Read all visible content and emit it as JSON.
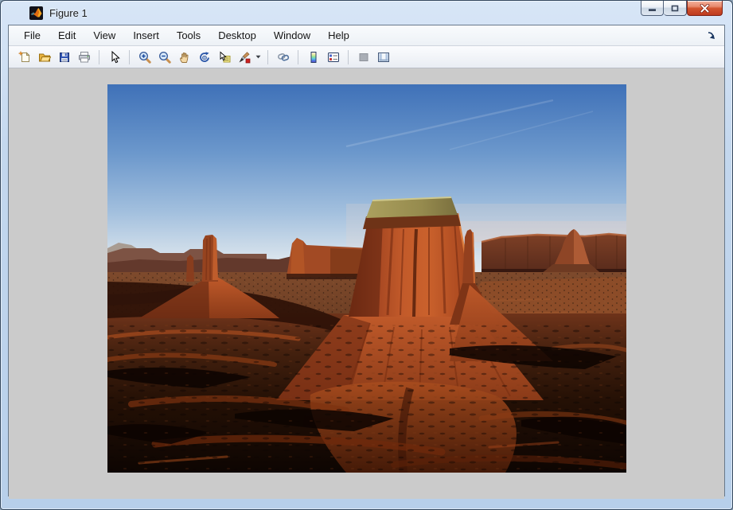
{
  "window": {
    "title": "Figure 1",
    "app_icon": "matlab-logo-icon",
    "controls": [
      {
        "name": "minimize-button",
        "glyph": "minimize"
      },
      {
        "name": "restore-button",
        "glyph": "restore"
      },
      {
        "name": "close-button",
        "glyph": "close"
      }
    ]
  },
  "menu_bar": {
    "items": [
      "File",
      "Edit",
      "View",
      "Insert",
      "Tools",
      "Desktop",
      "Window",
      "Help"
    ],
    "dock_icon": "dock-figure-arrow-icon"
  },
  "toolbar": {
    "buttons": [
      {
        "name": "new-figure",
        "icon": "new-document-icon"
      },
      {
        "name": "open-file",
        "icon": "open-folder-icon"
      },
      {
        "name": "save-figure",
        "icon": "save-floppy-icon"
      },
      {
        "name": "print-figure",
        "icon": "printer-icon"
      },
      {
        "name": "edit-plot",
        "icon": "arrow-pointer-icon"
      },
      {
        "name": "zoom-in",
        "icon": "zoom-in-icon"
      },
      {
        "name": "zoom-out",
        "icon": "zoom-out-icon"
      },
      {
        "name": "pan",
        "icon": "hand-icon"
      },
      {
        "name": "rotate-3d",
        "icon": "rotate-3d-icon"
      },
      {
        "name": "data-cursor",
        "icon": "data-cursor-icon"
      },
      {
        "name": "brush-data",
        "icon": "brush-icon",
        "has_dropdown": true
      },
      {
        "name": "link-plot",
        "icon": "chain-link-icon"
      },
      {
        "name": "insert-colorbar",
        "icon": "colorbar-icon"
      },
      {
        "name": "insert-legend",
        "icon": "legend-icon"
      },
      {
        "name": "hide-plot-tools",
        "icon": "hide-plot-tools-icon",
        "disabled": true
      },
      {
        "name": "show-plot-tools",
        "icon": "show-plot-tools-icon"
      }
    ]
  },
  "figure_canvas": {
    "background_color": "#cbcbcb",
    "image": {
      "subject": "Monument Valley desert buttes at sunset",
      "description": "Large sunlit red-rock butte with flat tan caprock in the center, a tall rock spire on a talus cone at left, flat-topped mesas on the horizon, scrub-dotted desert flats with long shadows, and a dark rocky red foreground under a clear gradient blue sky",
      "palette": {
        "sky_top": "#4173ba",
        "sky_horizon": "#e7ebee",
        "rock_sunlit": "#c25a2a",
        "rock_shadow": "#5e2413",
        "caprock": "#a09659",
        "desert_flats": "#7a452b",
        "foreground_dark": "#140602"
      }
    }
  }
}
